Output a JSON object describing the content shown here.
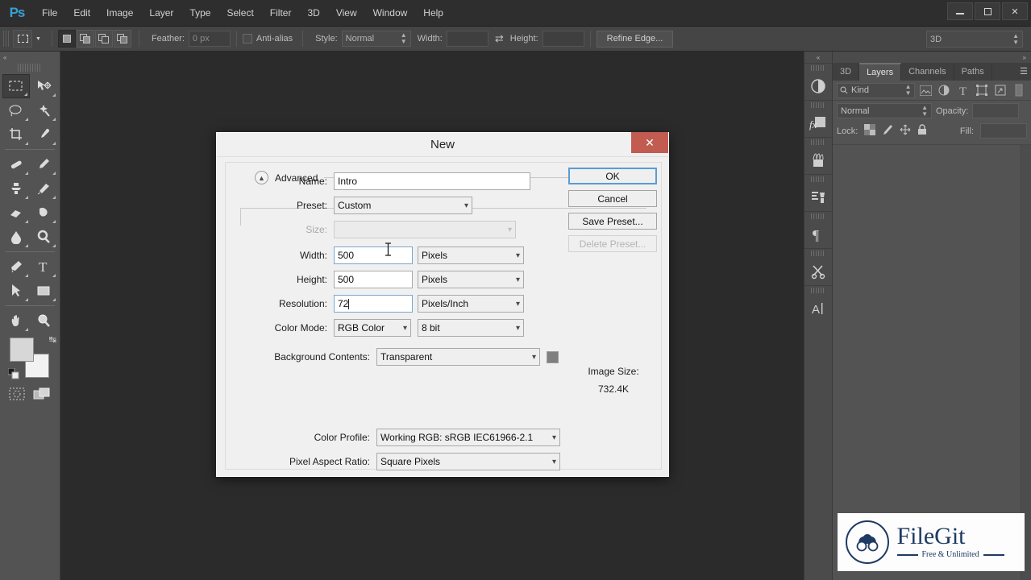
{
  "app": {
    "logo": "Ps",
    "menus": [
      "File",
      "Edit",
      "Image",
      "Layer",
      "Type",
      "Select",
      "Filter",
      "3D",
      "View",
      "Window",
      "Help"
    ],
    "window_controls": {
      "minimize": "minimize-icon",
      "maximize": "maximize-icon",
      "close": "✕"
    }
  },
  "options_bar": {
    "tool_icon": "rectangular-marquee-icon",
    "tool_preset_arrow": "▼",
    "selection_modes": [
      "new-selection",
      "add-to-selection",
      "subtract-from-selection",
      "intersect-with-selection"
    ],
    "feather_label": "Feather:",
    "feather_value": "0 px",
    "antialias_label": "Anti-alias",
    "style_label": "Style:",
    "style_value": "Normal",
    "width_label": "Width:",
    "width_value": "",
    "height_label": "Height:",
    "height_value": "",
    "swap_icon": "⇄",
    "refine_edge_label": "Refine Edge...",
    "workspace_value": "3D"
  },
  "toolbar": {
    "collapse_icon": "«",
    "tools": [
      "rectangular-marquee-tool",
      "move-tool",
      "lasso-tool",
      "magic-wand-tool",
      "crop-tool",
      "eyedropper-tool",
      "spot-healing-brush-tool",
      "brush-tool",
      "clone-stamp-tool",
      "history-brush-tool",
      "eraser-tool",
      "gradient-tool",
      "blur-tool",
      "dodge-tool",
      "pen-tool",
      "horizontal-type-tool",
      "path-selection-tool",
      "rectangle-tool",
      "hand-tool",
      "zoom-tool"
    ],
    "foreground_color": "#d7d7d7",
    "background_color": "#f2f2f2",
    "swap_colors_icon": "swap-colors-icon",
    "default_colors_icon": "default-colors-icon",
    "quick_mask_icon": "quick-mask-icon",
    "screen_mode_icon": "screen-mode-icon"
  },
  "dock_strip": {
    "collapse_icon": "«",
    "items": [
      "adjustments-panel-icon",
      "styles-panel-icon",
      "brush-panel-icon",
      "clone-source-panel-icon",
      "paragraph-panel-icon",
      "timeline-panel-icon",
      "character-panel-icon"
    ]
  },
  "layers_panel": {
    "collapse_icon": "»",
    "tabs": [
      {
        "label": "3D",
        "active": false
      },
      {
        "label": "Layers",
        "active": true
      },
      {
        "label": "Channels",
        "active": false
      },
      {
        "label": "Paths",
        "active": false
      }
    ],
    "menu_icon": "panel-menu-icon",
    "filter": {
      "kind_label": "Kind",
      "search_icon": "search-icon",
      "stepper_icon": "↕",
      "type_filters": [
        "pixel-layer-filter-icon",
        "adjustment-layer-filter-icon",
        "type-layer-filter-icon",
        "shape-layer-filter-icon",
        "smart-object-filter-icon"
      ]
    },
    "blend_mode": "Normal",
    "opacity_label": "Opacity:",
    "opacity_value": "",
    "lock_label": "Lock:",
    "lock_icons": [
      "lock-transparent-pixels-icon",
      "lock-image-pixels-icon",
      "lock-position-icon",
      "lock-all-icon"
    ],
    "fill_label": "Fill:",
    "fill_value": "",
    "layers": []
  },
  "dialog": {
    "title": "New",
    "close_label": "✕",
    "fields": {
      "name_label": "Name:",
      "name_value": "Intro",
      "preset_label": "Preset:",
      "preset_value": "Custom",
      "size_label": "Size:",
      "size_value": "",
      "width_label": "Width:",
      "width_value": "500",
      "width_unit": "Pixels",
      "height_label": "Height:",
      "height_value": "500",
      "height_unit": "Pixels",
      "resolution_label": "Resolution:",
      "resolution_value": "72",
      "resolution_unit": "Pixels/Inch",
      "color_mode_label": "Color Mode:",
      "color_mode_value": "RGB Color",
      "bit_depth_value": "8 bit",
      "background_contents_label": "Background Contents:",
      "background_contents_value": "Transparent",
      "background_swatch_color": "#808080"
    },
    "advanced": {
      "toggle_icon": "▲",
      "label": "Advanced",
      "color_profile_label": "Color Profile:",
      "color_profile_value": "Working RGB:  sRGB IEC61966-2.1",
      "pixel_aspect_ratio_label": "Pixel Aspect Ratio:",
      "pixel_aspect_ratio_value": "Square Pixels"
    },
    "buttons": {
      "ok": "OK",
      "cancel": "Cancel",
      "save_preset": "Save Preset...",
      "delete_preset": "Delete Preset..."
    },
    "image_size": {
      "label": "Image Size:",
      "value": "732.4K"
    }
  },
  "watermark": {
    "name": "FileGit",
    "tagline": "Free & Unlimited",
    "logo_icon": "filegit-logo-icon"
  },
  "colors": {
    "accent": "#3aa0d8",
    "close_red": "#c25b50",
    "focus_blue": "#5b9bd5",
    "canvas": "#2b2b2b",
    "panel": "#535353",
    "dialog": "#f0f0f0"
  }
}
